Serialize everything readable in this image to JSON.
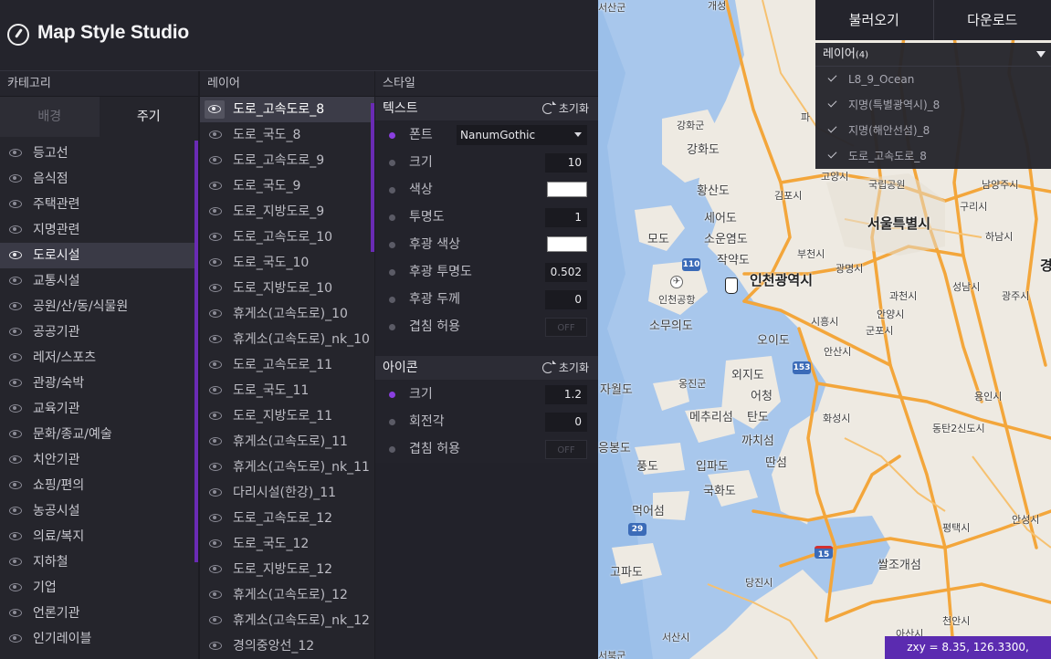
{
  "app": {
    "title": "Map Style Studio"
  },
  "columns": {
    "category": "카테고리",
    "layer": "레이어",
    "style": "스타일"
  },
  "category": {
    "tabs": [
      {
        "label": "배경",
        "active": false
      },
      {
        "label": "주기",
        "active": true
      }
    ],
    "items": [
      "등고선",
      "음식점",
      "주택관련",
      "지명관련",
      "도로시설",
      "교통시설",
      "공원/산/동/식물원",
      "공공기관",
      "레저/스포츠",
      "관광/숙박",
      "교육기관",
      "문화/종교/예술",
      "치안기관",
      "쇼핑/편의",
      "농공시설",
      "의료/복지",
      "지하철",
      "기업",
      "언론기관",
      "인기레이블"
    ],
    "selected": "도로시설"
  },
  "layers": {
    "items": [
      "도로_고속도로_8",
      "도로_국도_8",
      "도로_고속도로_9",
      "도로_국도_9",
      "도로_지방도로_9",
      "도로_고속도로_10",
      "도로_국도_10",
      "도로_지방도로_10",
      "휴게소(고속도로)_10",
      "휴게소(고속도로)_nk_10",
      "도로_고속도로_11",
      "도로_국도_11",
      "도로_지방도로_11",
      "휴게소(고속도로)_11",
      "휴게소(고속도로)_nk_11",
      "다리시설(한강)_11",
      "도로_고속도로_12",
      "도로_국도_12",
      "도로_지방도로_12",
      "휴게소(고속도로)_12",
      "휴게소(고속도로)_nk_12",
      "경의중앙선_12"
    ],
    "selected": "도로_고속도로_8"
  },
  "style": {
    "text": {
      "title": "텍스트",
      "reset": "초기화",
      "props": {
        "font": {
          "label": "폰트",
          "value": "NanumGothic"
        },
        "size": {
          "label": "크기",
          "value": "10"
        },
        "color": {
          "label": "색상",
          "value": "#ffffff"
        },
        "opacity": {
          "label": "투명도",
          "value": "1"
        },
        "halo_color": {
          "label": "후광 색상",
          "value": "#ffffff"
        },
        "halo_opacity": {
          "label": "후광 투명도",
          "value": "0.502"
        },
        "halo_width": {
          "label": "후광 두께",
          "value": "0"
        },
        "overlap": {
          "label": "겹침 허용",
          "value": "OFF"
        }
      }
    },
    "icon": {
      "title": "아이콘",
      "reset": "초기화",
      "props": {
        "size": {
          "label": "크기",
          "value": "1.2"
        },
        "rotation": {
          "label": "회전각",
          "value": "0"
        },
        "overlap": {
          "label": "겹침 허용",
          "value": "OFF"
        }
      }
    }
  },
  "top_actions": {
    "load": "불러오기",
    "download": "다운로드"
  },
  "layer_panel": {
    "title": "레이어",
    "count": "(4)",
    "items": [
      "L8_9_Ocean",
      "지명(특별광역시)_8",
      "지명(해안선섬)_8",
      "도로_고속도로_8"
    ]
  },
  "map": {
    "labels": {
      "gaesung": "개성",
      "hwaseongun": "강화군",
      "ganghwado": "강화도",
      "hwangsando": "황산도",
      "gimpo": "김포시",
      "sinseodo": "세어도",
      "soeyongdo": "소운염도",
      "modo": "모도",
      "jakyakdo": "작약도",
      "incheon": "인천광역시",
      "airport": "인천공항",
      "somuido": "소무의도",
      "bucheon": "부천시",
      "seoul": "서울특별시",
      "goyang": "고양시",
      "gukripgongwon": "국립공원",
      "guri": "구리시",
      "namyangju": "남양주시",
      "hanam": "하남시",
      "gwangmyeong": "광명시",
      "siheung": "시흥시",
      "ansan": "안산시",
      "gwacheon": "과천시",
      "seongnam": "성남시",
      "gwangju": "광주시",
      "uiwang": "안양시",
      "gunpo": "군포시",
      "oido": "오이도",
      "ongjin": "옹진군",
      "jawoldo": "자월도",
      "oijido": "외지도",
      "eocheong": "어청",
      "mechurisum": "메추리섬",
      "tando": "탄도",
      "hwaseong": "화성시",
      "yongin": "용인시",
      "dongtan": "동탄2신도시",
      "kkachiseom": "까치섬",
      "ttanseom": "딴섬",
      "pungdo": "풍도",
      "ipado": "입파도",
      "gukhwado": "국화도",
      "meogeoseom": "먹어섬",
      "pyeongtaek": "평택시",
      "anseong": "안성시",
      "gopado": "고파도",
      "dangjin": "당진시",
      "ssalsugaeseong": "쌀조개섬",
      "asan": "아산시",
      "cheonan": "천안시",
      "seosan": "서산시",
      "seobukgun": "서북군",
      "pabu": "파",
      "kyeong": "경",
      "eungbongdo": "응봉도",
      "top_left": "서산군",
      "seosan_bottom": "서산시"
    },
    "shields": {
      "r110": "110",
      "r153": "153",
      "r29": "29",
      "r15": "15"
    },
    "coord": "zxy = 8.35, 126.3300, 37.3630"
  }
}
